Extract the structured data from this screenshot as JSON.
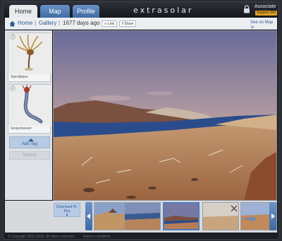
{
  "nav": {
    "tabs": [
      {
        "label": "Home",
        "active": true
      },
      {
        "label": "Map",
        "active": false
      },
      {
        "label": "Profile",
        "active": false
      }
    ],
    "brand": "extrasolar",
    "account": {
      "level": "Associate",
      "support_label": "Support XRI"
    }
  },
  "breadcrumb": {
    "home": "Home",
    "gallery": "Gallery",
    "days_ago": "1677 days ago",
    "link_label": "Link",
    "share_label": "Share",
    "see_on_map": "See on Map"
  },
  "tags": {
    "items": [
      {
        "number": "1",
        "caption": "Spindlepus"
      },
      {
        "number": "2",
        "caption": "Serpentweed"
      }
    ],
    "add_label": "Add Tag",
    "submit_label": "Submit"
  },
  "photo": {
    "sky_top": "#6a6b9a",
    "sky_bottom": "#b79da0",
    "water": "#2a4c8c",
    "ground": "#b67d55"
  },
  "gallery": {
    "download_label": "Download Hi-Res",
    "thumbnails": [
      {
        "name": "thumb-1",
        "selected": false
      },
      {
        "name": "thumb-2",
        "selected": false
      },
      {
        "name": "thumb-3",
        "selected": true
      },
      {
        "name": "thumb-4",
        "selected": false
      },
      {
        "name": "thumb-5",
        "selected": false
      }
    ]
  },
  "footer": {
    "copyright": "© Copyright 2011-2016. All rights reserved.",
    "report": "Report a problem"
  },
  "colors": {
    "accent": "#3f6aa3",
    "support": "#e0a020"
  }
}
